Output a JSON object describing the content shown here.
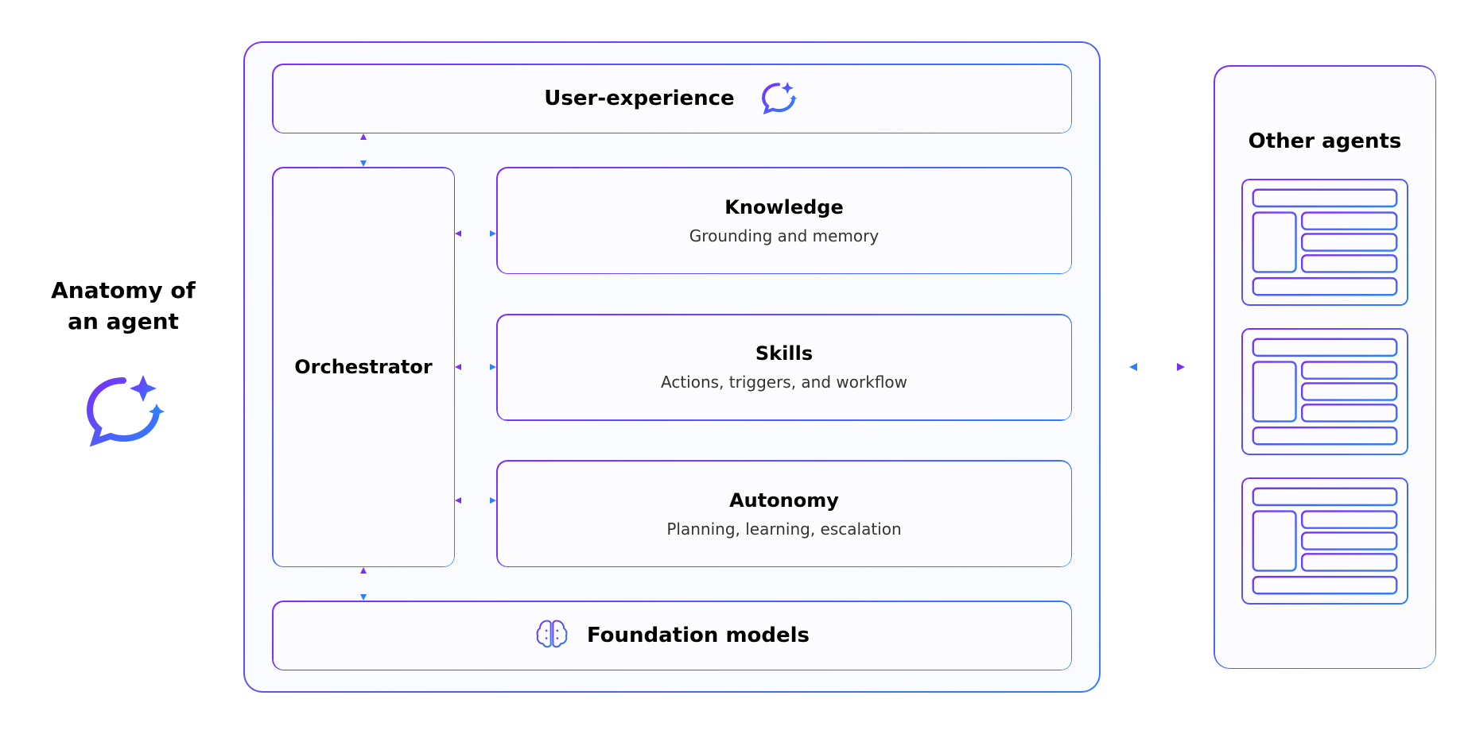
{
  "left_label": {
    "line1": "Anatomy of",
    "line2": "an agent"
  },
  "agent": {
    "ux": {
      "title": "User-experience"
    },
    "orchestrator": {
      "title": "Orchestrator"
    },
    "capabilities": [
      {
        "title": "Knowledge",
        "sub": "Grounding and memory"
      },
      {
        "title": "Skills",
        "sub": "Actions, triggers, and workflow"
      },
      {
        "title": "Autonomy",
        "sub": "Planning, learning, escalation"
      }
    ],
    "foundation": {
      "title": "Foundation models"
    }
  },
  "other": {
    "title": "Other agents"
  },
  "icons": {
    "chat_sparkle": "chat-sparkle-icon",
    "brain": "brain-icon"
  },
  "colors": {
    "purple": "#7b2ff7",
    "blue": "#2e7fff"
  }
}
